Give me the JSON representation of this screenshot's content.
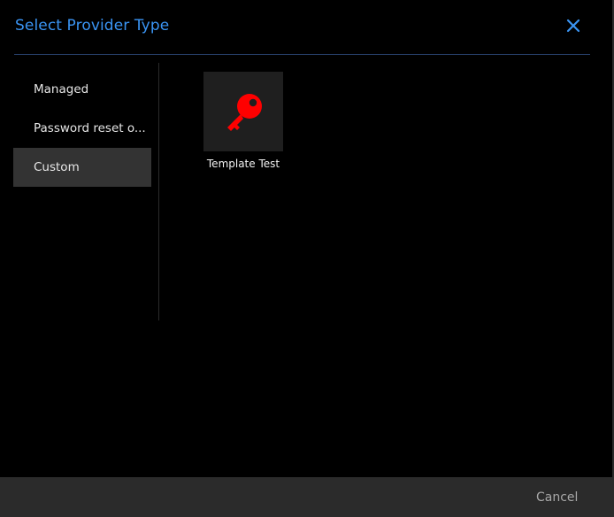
{
  "dialog": {
    "title": "Select Provider Type",
    "close_icon": "close-icon"
  },
  "sidebar": {
    "items": [
      {
        "label": "Managed",
        "active": false
      },
      {
        "label": "Password reset o...",
        "active": false
      },
      {
        "label": "Custom",
        "active": true
      }
    ]
  },
  "providers": [
    {
      "label": "Template Test",
      "icon": "key-icon",
      "icon_color": "#ff0000"
    }
  ],
  "footer": {
    "cancel_label": "Cancel"
  },
  "colors": {
    "accent": "#3a94f3",
    "background": "#000000",
    "selected_item": "#333333",
    "footer": "#2b2b2b"
  }
}
